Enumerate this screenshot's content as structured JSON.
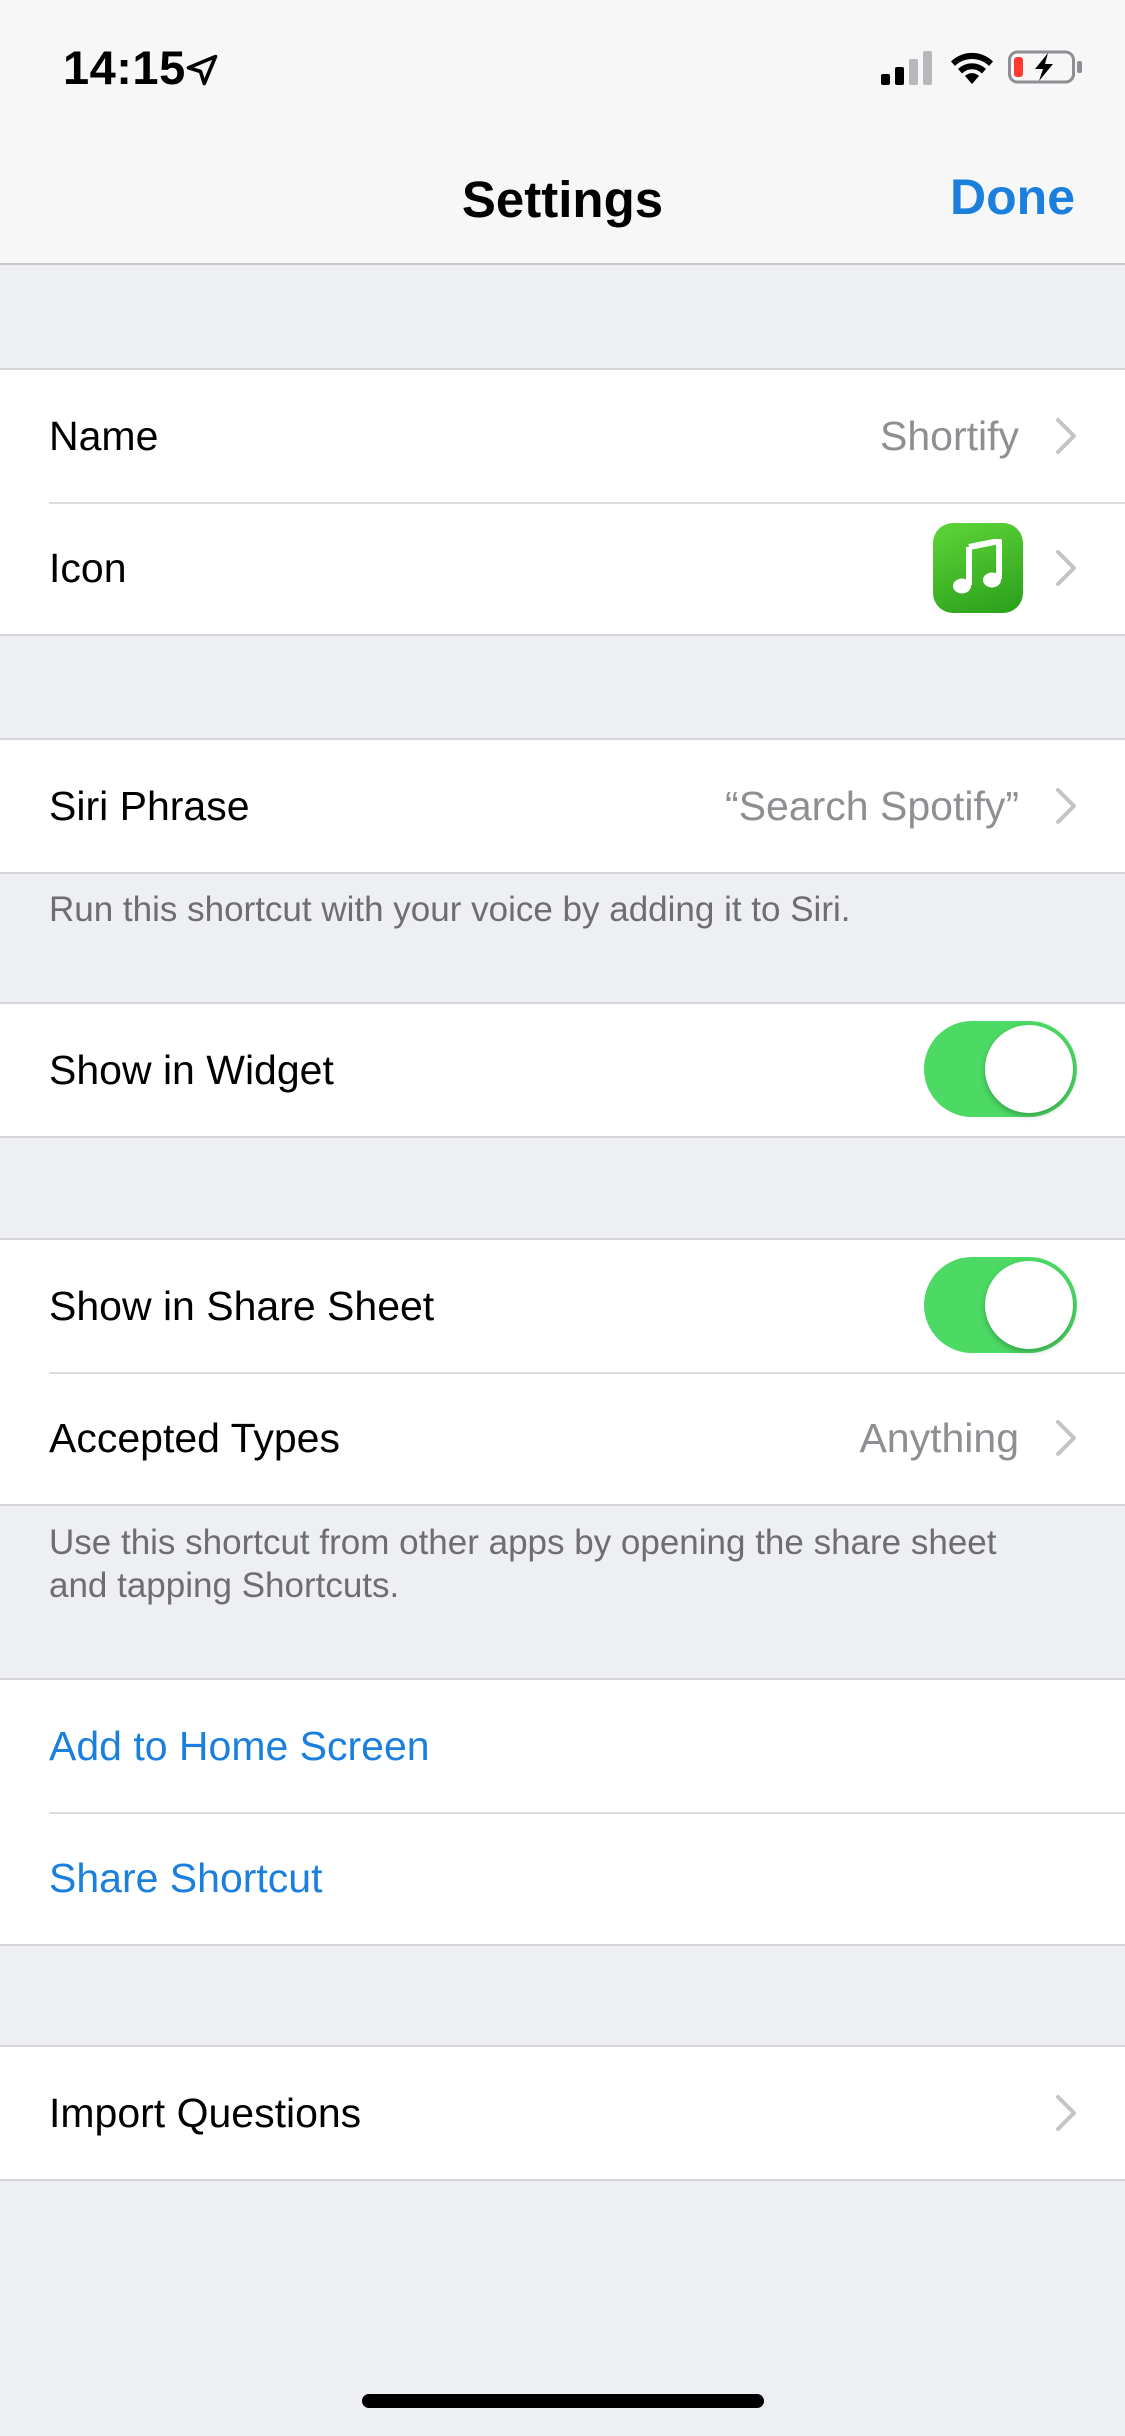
{
  "status_bar": {
    "time": "14:15",
    "icons": [
      "location-arrow-icon",
      "cellular-signal-icon",
      "wifi-icon",
      "battery-charging-icon"
    ]
  },
  "nav": {
    "title": "Settings",
    "done_label": "Done"
  },
  "colors": {
    "accent": "#1a7fdd",
    "toggle_on": "#4cd964",
    "secondary_text": "#8e8e93",
    "footer_text": "#6d6d72",
    "background": "#edeff2"
  },
  "group1": {
    "name_label": "Name",
    "name_value": "Shortify",
    "icon_label": "Icon",
    "icon_glyph": "music-note-icon"
  },
  "group2": {
    "siri_label": "Siri Phrase",
    "siri_value": "“Search Spotify”",
    "footer": "Run this shortcut with your voice by adding it to Siri."
  },
  "group3": {
    "widget_label": "Show in Widget",
    "widget_on": true
  },
  "group4": {
    "share_sheet_label": "Show in Share Sheet",
    "share_sheet_on": true,
    "accepted_label": "Accepted Types",
    "accepted_value": "Anything",
    "footer": "Use this shortcut from other apps by opening the share sheet and tapping Shortcuts."
  },
  "group5": {
    "home_screen_label": "Add to Home Screen",
    "share_shortcut_label": "Share Shortcut"
  },
  "group6": {
    "import_label": "Import Questions"
  }
}
